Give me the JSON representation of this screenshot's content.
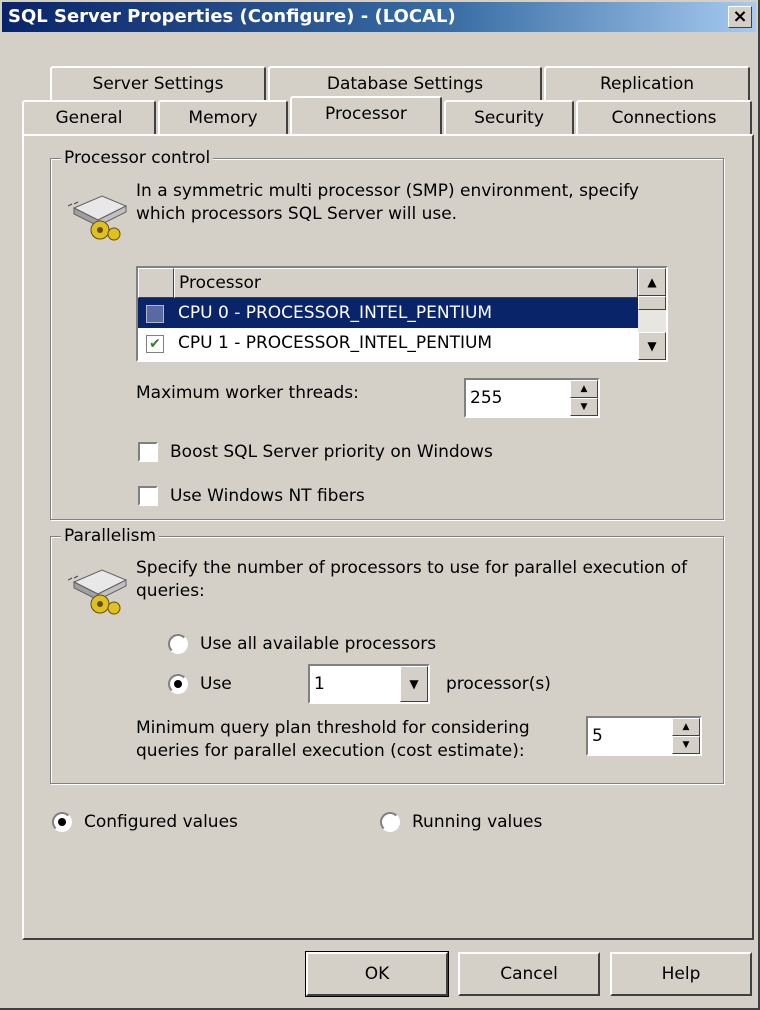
{
  "window": {
    "title": "SQL Server Properties (Configure) - (LOCAL)",
    "close_label": "×"
  },
  "tabs": {
    "row1": [
      "Server Settings",
      "Database Settings",
      "Replication"
    ],
    "row2": [
      "General",
      "Memory",
      "Processor",
      "Security",
      "Connections"
    ],
    "active": "Processor"
  },
  "processor_control": {
    "label": "Processor control",
    "description_line1": "In a symmetric multi processor (SMP) environment, specify",
    "description_line2": "which processors SQL Server will use.",
    "list_header": "Processor",
    "rows": [
      {
        "label": "CPU 0 - PROCESSOR_INTEL_PENTIUM",
        "checked": false,
        "selected": true
      },
      {
        "label": "CPU 1 - PROCESSOR_INTEL_PENTIUM",
        "checked": true,
        "selected": false
      }
    ],
    "max_threads_label": "Maximum worker threads:",
    "max_threads_value": "255",
    "boost_label": "Boost SQL Server priority on Windows",
    "fibers_label": "Use Windows NT fibers"
  },
  "parallelism": {
    "label": "Parallelism",
    "description_line1": "Specify the number of processors to use for parallel execution of",
    "description_line2": "queries:",
    "use_all_label": "Use all available processors",
    "use_label": "Use",
    "use_value": "1",
    "processors_suffix": "processor(s)",
    "threshold_line1": "Minimum query plan threshold for considering",
    "threshold_line2": "queries for parallel execution (cost estimate):",
    "threshold_value": "5"
  },
  "values_mode": {
    "configured_label": "Configured values",
    "running_label": "Running values",
    "selected": "configured"
  },
  "buttons": {
    "ok": "OK",
    "cancel": "Cancel",
    "help": "Help"
  }
}
